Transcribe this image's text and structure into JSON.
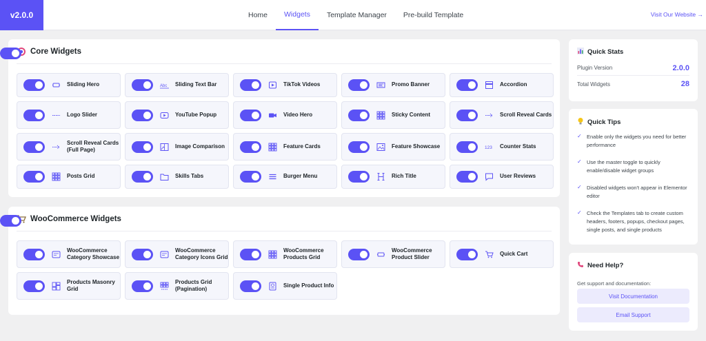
{
  "header": {
    "version": "v2.0.0",
    "nav": [
      "Home",
      "Widgets",
      "Template Manager",
      "Pre-build Template"
    ],
    "active_tab": "Widgets",
    "visit_link": "Visit Our Website →"
  },
  "core": {
    "title": "Core Widgets",
    "icon": "target-icon",
    "enabled": true,
    "widgets": [
      {
        "label": "Sliding Hero",
        "icon": "slider-icon",
        "enabled": true
      },
      {
        "label": "Sliding Text Bar",
        "icon": "text-icon",
        "enabled": true
      },
      {
        "label": "TikTok Videos",
        "icon": "video-play-icon",
        "enabled": true
      },
      {
        "label": "Promo Banner",
        "icon": "banner-icon",
        "enabled": true
      },
      {
        "label": "Accordion",
        "icon": "accordion-icon",
        "enabled": true
      },
      {
        "label": "Logo Slider",
        "icon": "logo-slider-icon",
        "enabled": true
      },
      {
        "label": "YouTube Popup",
        "icon": "youtube-icon",
        "enabled": true
      },
      {
        "label": "Video Hero",
        "icon": "camera-icon",
        "enabled": true
      },
      {
        "label": "Sticky Content",
        "icon": "grid-icon",
        "enabled": true
      },
      {
        "label": "Scroll Reveal Cards",
        "icon": "scroll-icon",
        "enabled": true
      },
      {
        "label": "Scroll Reveal Cards (Full Page)",
        "icon": "scroll-icon",
        "enabled": true
      },
      {
        "label": "Image Comparison",
        "icon": "image-compare-icon",
        "enabled": true
      },
      {
        "label": "Feature Cards",
        "icon": "grid-icon",
        "enabled": true
      },
      {
        "label": "Feature Showcase",
        "icon": "image-icon",
        "enabled": true
      },
      {
        "label": "Counter Stats",
        "icon": "counter-icon",
        "enabled": true
      },
      {
        "label": "Posts Grid",
        "icon": "grid-icon",
        "enabled": true
      },
      {
        "label": "Skills Tabs",
        "icon": "folder-icon",
        "enabled": true
      },
      {
        "label": "Burger Menu",
        "icon": "menu-icon",
        "enabled": true
      },
      {
        "label": "Rich Title",
        "icon": "heading-icon",
        "enabled": true
      },
      {
        "label": "User Reviews",
        "icon": "comment-icon",
        "enabled": true
      }
    ]
  },
  "woo": {
    "title": "WooCommerce Widgets",
    "icon": "cart-icon",
    "enabled": true,
    "widgets": [
      {
        "label": "WooCommerce Category Showcase",
        "icon": "category-icon",
        "enabled": true
      },
      {
        "label": "WooCommerce Category Icons Grid",
        "icon": "category-icon",
        "enabled": true
      },
      {
        "label": "WooCommerce Products Grid",
        "icon": "grid-icon",
        "enabled": true
      },
      {
        "label": "WooCommerce Product Slider",
        "icon": "slider-icon",
        "enabled": true
      },
      {
        "label": "Quick Cart",
        "icon": "cart-icon",
        "enabled": true
      },
      {
        "label": "Products Masonry Grid",
        "icon": "masonry-icon",
        "enabled": true
      },
      {
        "label": "Products Grid (Pagination)",
        "icon": "grid-pagination-icon",
        "enabled": true
      },
      {
        "label": "Single Product Info",
        "icon": "product-info-icon",
        "enabled": true
      }
    ]
  },
  "stats": {
    "title": "Quick Stats",
    "rows": [
      {
        "label": "Plugin Version",
        "value": "2.0.0"
      },
      {
        "label": "Total Widgets",
        "value": "28"
      }
    ]
  },
  "tips": {
    "title": "Quick Tips",
    "items": [
      "Enable only the widgets you need for better performance",
      "Use the master toggle to quickly enable/disable widget groups",
      "Disabled widgets won't appear in Elementor editor",
      "Check the Templates tab to create custom headers, footers, popups, checkout pages, single posts, and single products"
    ]
  },
  "help": {
    "title": "Need Help?",
    "subtitle": "Get support and documentation:",
    "buttons": [
      "Visit Documentation",
      "Email Support"
    ]
  },
  "colors": {
    "accent": "#5b52f5",
    "card_bg": "#f5f6fc",
    "page_bg": "#f0f0f1"
  }
}
